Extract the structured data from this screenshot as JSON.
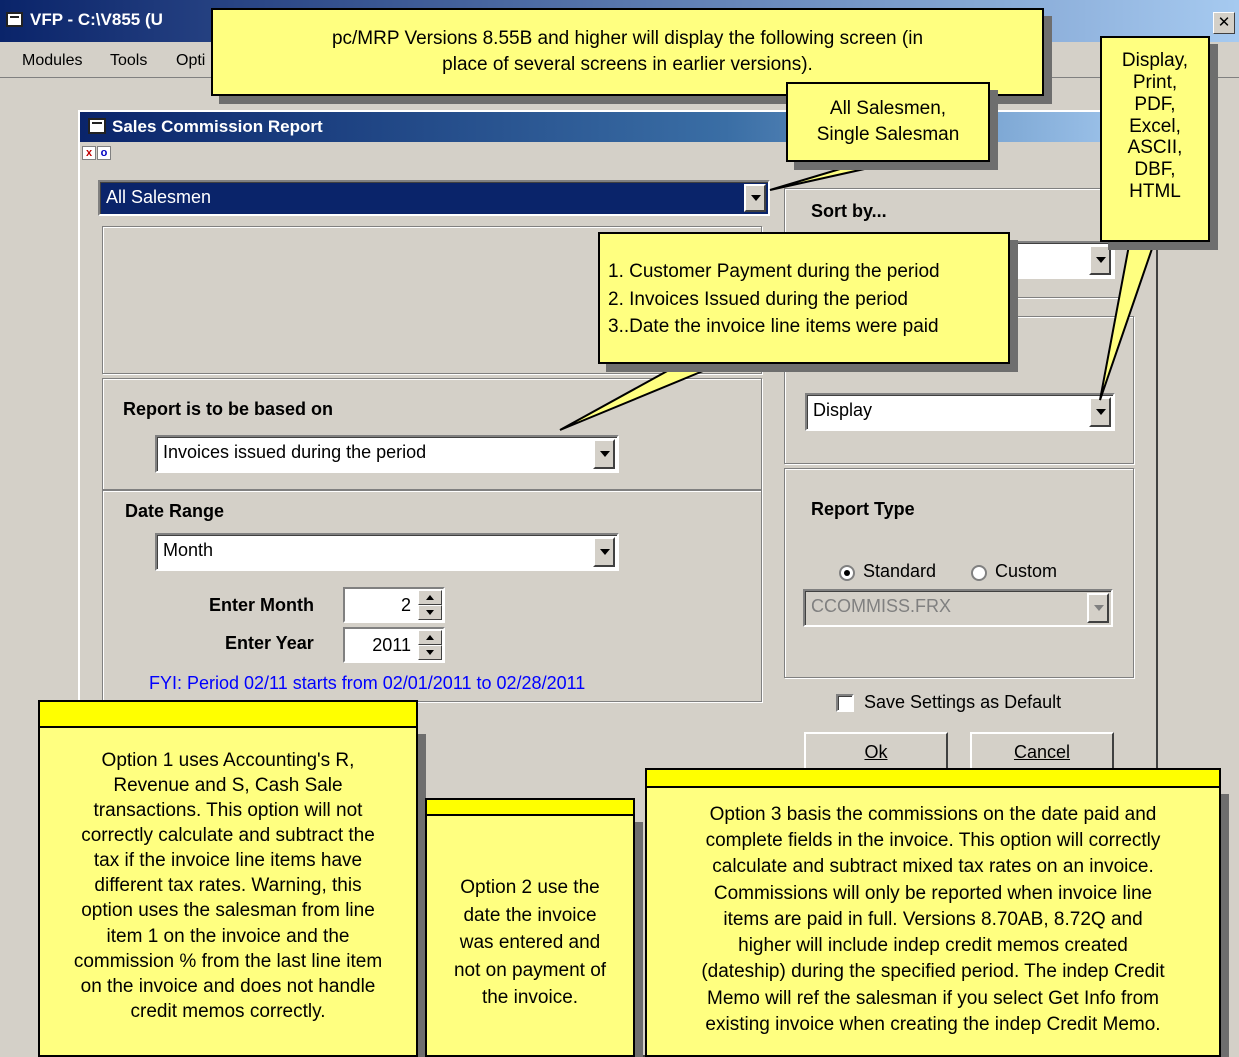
{
  "app": {
    "title": "VFP - C:\\V855 (U",
    "close_glyph": "✕",
    "menu": [
      "Modules",
      "Tools",
      "Opti"
    ]
  },
  "dialog": {
    "title": "Sales Commission Report",
    "close_mini": "x",
    "min_mini": "o",
    "salesman_select": "All Salesmen",
    "sort_label": "Sort by...",
    "based_on_label": "Report is to be based on",
    "based_on_select": "Invoices issued during the period",
    "date_range_label": "Date Range",
    "date_range_select": "Month",
    "enter_month_label": "Enter Month",
    "enter_month_value": "2",
    "enter_year_label": "Enter Year",
    "enter_year_value": "2011",
    "fyi_text": "FYI: Period 02/11 starts from 02/01/2011 to 02/28/2011",
    "output_select": "Display",
    "report_type_label": "Report Type",
    "standard_label": "Standard",
    "custom_label": "Custom",
    "report_type_selected": "Standard",
    "frx_select": "CCOMMISS.FRX",
    "save_default_label": "Save Settings as Default",
    "save_default_checked": false,
    "ok_label": "Ok",
    "cancel_label": "Cancel"
  },
  "callouts": {
    "top_line1": "pc/MRP Versions 8.55B and higher will display the following screen (in",
    "top_line2": "place of several screens in earlier versions).",
    "salesmen_line1": "All Salesmen,",
    "salesmen_line2": "Single Salesman",
    "output_lines": [
      "Display,",
      "Print,",
      "PDF,",
      "Excel,",
      "ASCII,",
      "DBF,",
      "HTML"
    ],
    "basis_line1": "1. Customer Payment during the period",
    "basis_line2": "2. Invoices Issued during the period",
    "basis_line3": "3..Date the invoice line items were paid",
    "option1_lines": [
      "Option 1 uses Accounting's R,",
      "Revenue and S, Cash Sale",
      "transactions. This option will not",
      "correctly calculate and subtract the",
      "tax if the invoice line items have",
      "different tax rates. Warning, this",
      "option uses the salesman from line",
      "item 1 on the invoice and the",
      "commission % from the last line item",
      "on the invoice and does not handle",
      "credit memos correctly."
    ],
    "option2_lines": [
      "Option 2 use the",
      "date the invoice",
      "was entered and",
      "not on payment of",
      "the invoice."
    ],
    "option3_lines": [
      "Option 3 basis the commissions on the date paid and",
      "complete fields in the invoice. This option will correctly",
      "calculate and subtract mixed tax rates on an invoice.",
      "Commissions will only be reported when invoice line",
      "items are paid in full.  Versions 8.70AB, 8.72Q and",
      "higher will include indep credit memos created",
      "(dateship) during the specified period. The indep Credit",
      "Memo will ref the salesman if you select Get Info from",
      "existing invoice when creating the indep Credit Memo."
    ]
  },
  "colors": {
    "callout_fill": "#ffff80",
    "callout_bar": "#ffff00",
    "titlebar": "#0a246a",
    "fyi_text": "#0000ff",
    "window_bg": "#d4d0c8"
  }
}
